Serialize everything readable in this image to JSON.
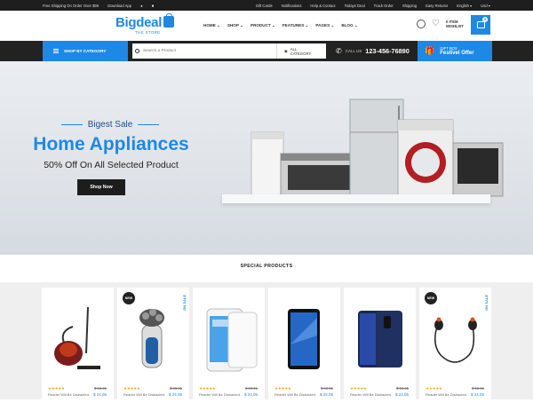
{
  "topbar": {
    "shipping": "Free Shipping On Order Over $99",
    "download": "Download App",
    "links": [
      "Gift Cards",
      "Notifications",
      "Help & Contact",
      "Todays Deal",
      "Track Order",
      "Shipping",
      "Easy Returns"
    ],
    "language": "English",
    "currency": "Usd"
  },
  "brand": {
    "name": "Bigdeal",
    "tagline": "THE STORE",
    "color": "#1e88e5"
  },
  "nav": [
    "HOME",
    "SHOP",
    "PRODUCT",
    "FEATURES",
    "PAGES",
    "BLOG"
  ],
  "wishlist": {
    "line1": "0 ITEM",
    "line2": "WISHLIST"
  },
  "cart": {
    "count": "0"
  },
  "searchbar": {
    "shop_by_category": "SHOP BY CATEGORY",
    "placeholder": "Search a Product",
    "all_category": "ALL CATEGORY",
    "call_label": "CALL US",
    "phone": "123-456-76890",
    "gift_line1": "GIFT BOX",
    "gift_line2": "Festivel Offer"
  },
  "hero": {
    "kicker": "Bigest Sale",
    "title": "Home Appliances",
    "subtitle": "50% Off On All Selected Product",
    "button": "Shop Now"
  },
  "products_section": {
    "title": "SPECIAL PRODUCTS",
    "items": [
      {
        "badge": "",
        "sale": "",
        "image": "vacuum-cleaner",
        "stars": "★★★★★",
        "old_price": "$ 56.21",
        "reader": "Reader Will Be Distracted.",
        "price": "$ 24.05"
      },
      {
        "badge": "NEW",
        "sale": "ON SALE",
        "image": "shaver",
        "stars": "★★★★★",
        "old_price": "$ 56.21",
        "reader": "Reader Will Be Distracted.",
        "price": "$ 24.05"
      },
      {
        "badge": "",
        "sale": "",
        "image": "white-smartphone",
        "stars": "★★★★★",
        "old_price": "$ 56.21",
        "reader": "Reader Will Be Distracted.",
        "price": "$ 24.05"
      },
      {
        "badge": "",
        "sale": "",
        "image": "black-smartphone",
        "stars": "★★★★★",
        "old_price": "$ 56.21",
        "reader": "Reader Will Be Distracted.",
        "price": "$ 24.05"
      },
      {
        "badge": "",
        "sale": "",
        "image": "galaxy-phone",
        "stars": "★★★★★",
        "old_price": "$ 56.21",
        "reader": "Reader Will Be Distracted.",
        "price": "$ 24.05"
      },
      {
        "badge": "NEW",
        "sale": "ON SALE",
        "image": "earphones",
        "stars": "★★★★★",
        "old_price": "$ 56.21",
        "reader": "Reader Will Be Distracted.",
        "price": "$ 24.05"
      }
    ]
  },
  "colors": {
    "accent": "#1e88e5",
    "dark": "#222222",
    "stars": "#f5a623"
  }
}
